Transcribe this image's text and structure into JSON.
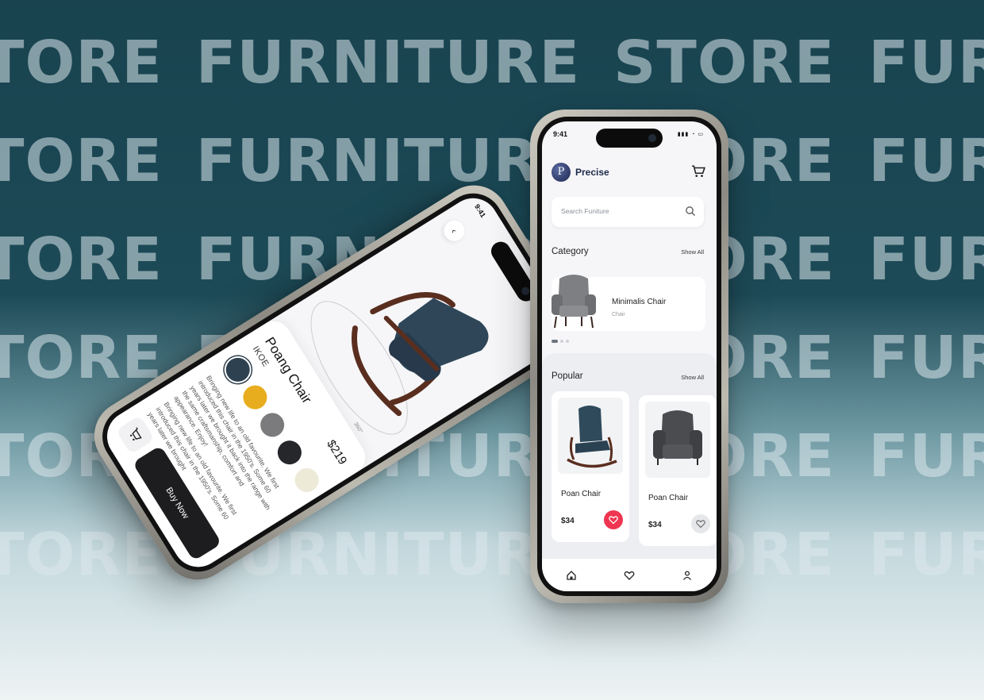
{
  "background": {
    "wordmark_rows": [
      "TORE FURNITURE STORE FURN",
      "TORE FURNITURE STORE FURN",
      "TORE FURNITURE STORE FURN",
      "TORE FURNITURE STORE FURN",
      "TORE FURNITURE STORE FURN",
      "TORE FURNITURE STORE FURN"
    ],
    "colors": {
      "top": "#18434f",
      "bottom": "#eef3f4"
    }
  },
  "detail_screen": {
    "status_time": "9:41",
    "back_icon": "chevron-left-icon",
    "rotation_label": "360°",
    "product_title": "Poang Chair",
    "brand": "IKOE",
    "price": "$219",
    "swatch_colors": [
      "#2e4150",
      "#e8ad1e",
      "#7b7b7d",
      "#26272b",
      "#eeead8"
    ],
    "selected_swatch": 0,
    "description": [
      "Bringing new life to an old favourite. We first introduced this chair in the 1950's. Some 60 years later we brought it back into the range with the same craftsmanship, comfort and appearance. Enjoy!",
      "Bringing new life to an old favourite. We first introduced this chair in the 1950's. Some 60 years later we brought"
    ],
    "cart_icon": "cart-icon",
    "buy_label": "Buy Now"
  },
  "home_screen": {
    "status_time": "9:41",
    "brand_letter": "P",
    "app_name": "Precise",
    "cart_icon": "cart-icon",
    "search_placeholder": "Search Funiture",
    "search_icon": "search-icon",
    "category": {
      "title": "Category",
      "show_all": "Show All",
      "items": [
        {
          "name": "Minimalis Chair",
          "type": "Chair"
        }
      ]
    },
    "popular": {
      "title": "Popular",
      "show_all": "Show All",
      "products": [
        {
          "name": "Poan Chair",
          "price": "$34",
          "favorited": true
        },
        {
          "name": "Poan Chair",
          "price": "$34",
          "favorited": false
        }
      ]
    },
    "tabs": [
      "home-icon",
      "heart-icon",
      "user-icon"
    ],
    "accent_color": "#ef3550"
  }
}
